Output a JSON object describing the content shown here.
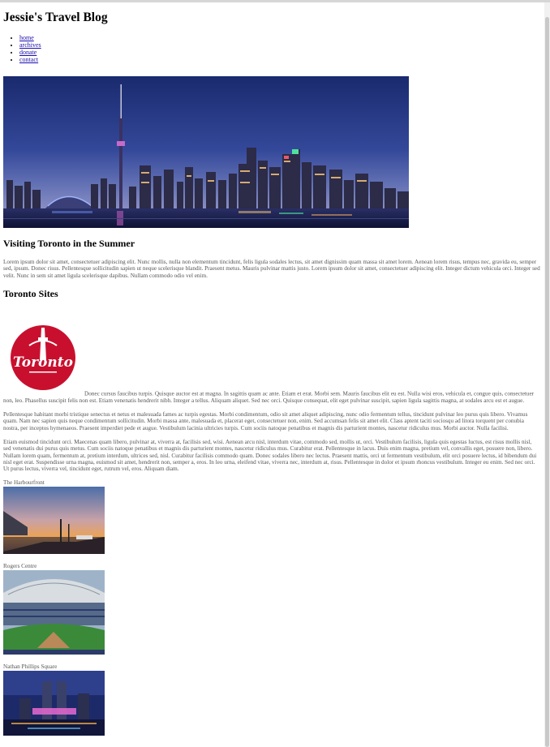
{
  "site": {
    "title": "Jessie's Travel Blog"
  },
  "nav": {
    "items": [
      "home",
      "archives",
      "donate",
      "contact"
    ]
  },
  "post": {
    "title": "Visiting Toronto in the Summer",
    "intro": "Lorem ipsum dolor sit amet, consectetuer adipiscing elit. Nunc mollis, nulla non elementum tincidunt, felis ligula sodales lectus, sit amet dignissim quam massa sit amet lorem. Aenean lorem risus, tempus nec, gravida eu, semper sed, ipsum. Donec risus. Pellentesque sollicitudin sapien ut neque scelerisque blandit. Praesent metus. Mauris pulvinar mattis justo. Lorem ipsum dolor sit amet, consectetuer adipiscing elit. Integer dictum vehicula orci. Integer sed velit. Nunc in sem sit amet ligula scelerisque dapibus. Nullam commodo odio vel enim."
  },
  "sites": {
    "title": "Toronto Sites",
    "logo_text": "Toronto",
    "para1": "Donec cursus faucibus turpis. Quisque auctor est at magna. In sagittis quam ac ante. Etiam et erat. Morbi sem. Mauris faucibus elit eu est. Nulla wisi eros, vehicula et, congue quis, consectetuer non, leo. Phasellus suscipit felis non est. Etiam venenatis hendrerit nibh. Integer a tellus. Aliquam aliquet. Sed nec orci. Quisque consequat, elit eget pulvinar suscipit, sapien ligula sagittis magna, at sodales arcu est et augue.",
    "para2": "Pellentesque habitant morbi tristique senectus et netus et malesuada fames ac turpis egestas. Morbi condimentum, odio sit amet aliquet adipiscing, nunc odio fermentum tellus, tincidunt pulvinar leo purus quis libero. Vivamus quam. Nam nec sapien quis neque condimentum sollicitudin. Morbi massa ante, malesuada et, placerat eget, consectetuer non, enim. Sed accumsan felis sit amet elit. Class aptent taciti sociosqu ad litora torquent per conubia nostra, per inceptos hymenaeos. Praesent imperdiet pede et augue. Vestibulum lacinia ultricies turpis. Cum sociis natoque penatibus et magnis dis parturient montes, nascetur ridiculus mus. Morbi auctor. Nulla facilisi.",
    "para3": "Etiam euismod tincidunt orci. Maecenas quam libero, pulvinar at, viverra at, facilisis sed, wisi. Aenean arcu nisl, interdum vitae, commodo sed, mollis ut, orci. Vestibulum facilisis, ligula quis egestas luctus, est risus mollis nisl, sed venenatis dui purus quis metus. Cum sociis natoque penatibus et magnis dis parturient montes, nascetur ridiculus mus. Curabitur erat. Pellentesque in lacus. Duis enim magna, pretium vel, convallis eget, posuere non, libero. Nullam lorem quam, fermentum at, pretium interdum, ultrices sed, nisl. Curabitur facilisis commodo quam. Donec sodales libero nec lectus. Praesent mattis, orci ut fermentum vestibulum, elit orci posuere lectus, id bibendum dui nisl eget erat. Suspendisse urna magna, euismod sit amet, hendrerit non, semper a, eros. In leo urna, eleifend vitae, viverra nec, interdum at, risus. Pellentesque in dolor et ipsum rhoncus vestibulum. Integer eu enim. Sed nec orci. Ut purus lectus, viverra vel, tincidunt eget, rutrum vel, eros. Aliquam diam."
  },
  "gallery": {
    "items": [
      {
        "caption": "The Harbourfront"
      },
      {
        "caption": "Rogers Centre"
      },
      {
        "caption": "Nathan Phillips Square"
      }
    ]
  }
}
